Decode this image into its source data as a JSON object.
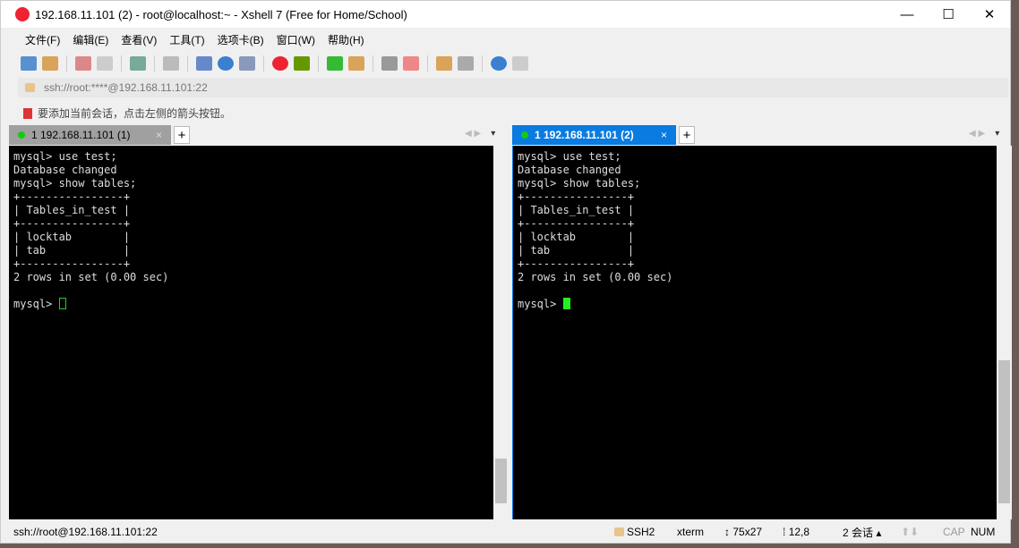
{
  "window": {
    "title": "192.168.11.101  (2)   - root@localhost:~ - Xshell 7 (Free for Home/School)",
    "minimize": "—",
    "maximize": "☐",
    "close": "✕"
  },
  "menu": [
    "文件(F)",
    "编辑(E)",
    "查看(V)",
    "工具(T)",
    "选项卡(B)",
    "窗口(W)",
    "帮助(H)"
  ],
  "address": "ssh://root:****@192.168.11.101:22",
  "hint": "要添加当前会话，点击左侧的箭头按钮。",
  "tabs": {
    "left": "1 192.168.11.101  (1)",
    "right": "1 192.168.11.101  (2)",
    "close": "×",
    "add": "+"
  },
  "terminal": {
    "left": "mysql> use test;\nDatabase changed\nmysql> show tables;\n+----------------+\n| Tables_in_test |\n+----------------+\n| locktab        |\n| tab            |\n+----------------+\n2 rows in set (0.00 sec)\n\nmysql> ",
    "right": "mysql> use test;\nDatabase changed\nmysql> show tables;\n+----------------+\n| Tables_in_test |\n+----------------+\n| locktab        |\n| tab            |\n+----------------+\n2 rows in set (0.00 sec)\n\nmysql> "
  },
  "status": {
    "left": "ssh://root@192.168.11.101:22",
    "protocol": "SSH2",
    "term": "xterm",
    "size": "75x27",
    "pos": "12,8",
    "sessions": "2 会话",
    "cap": "CAP",
    "num": "NUM"
  }
}
